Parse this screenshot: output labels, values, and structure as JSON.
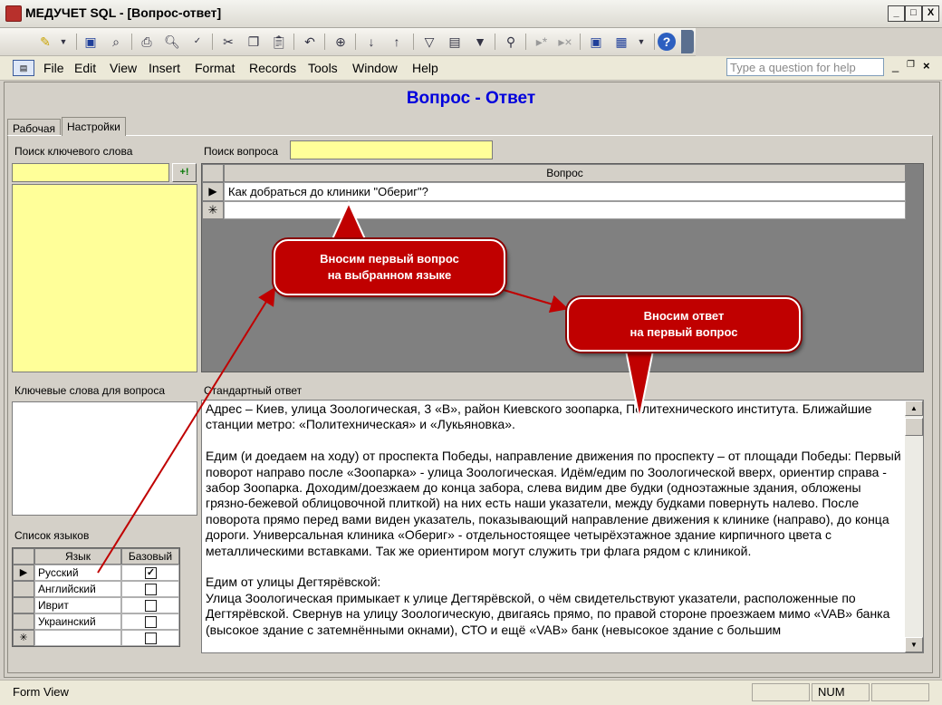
{
  "window": {
    "title": "МЕДУЧЕТ SQL - [Вопрос-ответ]",
    "min": "_",
    "max": "□",
    "close": "X"
  },
  "menu": [
    "File",
    "Edit",
    "View",
    "Insert",
    "Format",
    "Records",
    "Tools",
    "Window",
    "Help"
  ],
  "help_box": {
    "placeholder": "Type a question for help"
  },
  "form": {
    "title": "Вопрос - Ответ",
    "tabs": [
      "Рабочая",
      "Настройки"
    ],
    "keyword_search": {
      "label": "Поиск ключевого слова",
      "add_button": "+!"
    },
    "question_search": {
      "label": "Поиск вопроса"
    },
    "question_grid": {
      "header": "Вопрос",
      "rows": [
        "Как добраться до клиники \"Обериг\"?",
        ""
      ]
    },
    "keywords_label": "Ключевые слова для вопроса",
    "answer_label": "Стандартный ответ",
    "answer_text": "Адрес – Киев, улица Зоологическая, 3 «В», район Киевского зоопарка, Политехнического института. Ближайшие станции метро: «Политехническая» и «Лукьяновка».\n\nЕдим (и доедаем на ходу) от проспекта Победы, направление движения по проспекту – от площади Победы: Первый поворот направо после «Зоопарка» - улица Зоологическая. Идём/едим по Зоологической вверх, ориентир справа - забор Зоопарка. Доходим/доезжаем до конца забора, слева видим две будки (одноэтажные здания, обложены грязно-бежевой облицовочной плиткой) на них есть наши указатели, между будками повернуть налево. После поворота прямо перед вами виден указатель, показывающий направление движения к клинике (направо), до конца дороги. Универсальная клиника «Обериг» - отдельностоящее четырёхэтажное здание кирпичного цвета с металлическими вставками. Так же ориентиром могут служить три флага рядом с клиникой.\n\nЕдим от улицы Дегтярёвской:\nУлица Зоологическая примыкает к улице Дегтярёвской, о чём свидетельствуют указатели, расположенные по Дегтярёвской. Свернув на улицу Зоологическую, двигаясь прямо, по правой стороне проезжаем мимо «VAB» банка (высокое здание с затемнёнными окнами), СТО и ещё «VAB» банк (невысокое здание с большим",
    "languages": {
      "label": "Список языков",
      "headers": [
        "Язык",
        "Базовый"
      ],
      "rows": [
        {
          "name": "Русский",
          "base": true
        },
        {
          "name": "Английский",
          "base": false
        },
        {
          "name": "Иврит",
          "base": false
        },
        {
          "name": "Украинский",
          "base": false
        },
        {
          "name": "",
          "base": false
        }
      ]
    }
  },
  "callouts": {
    "first": "Вносим первый вопрос\nна выбранном языке",
    "second": "Вносим ответ\nна первый вопрос"
  },
  "status": {
    "left": "Form View",
    "num": "NUM"
  },
  "colors": {
    "title_blue": "#0000dd",
    "yellow_field": "#ffff99",
    "callout_red": "#c00000"
  }
}
